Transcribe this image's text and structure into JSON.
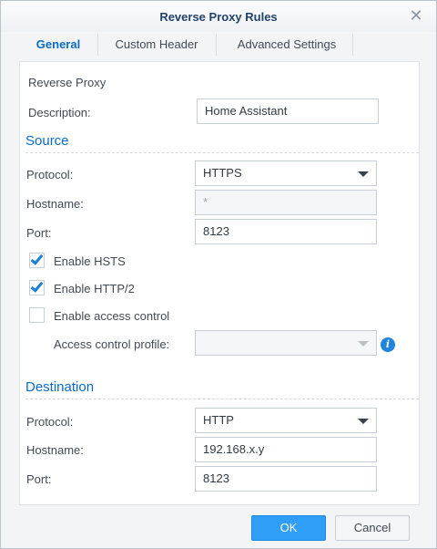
{
  "dialog": {
    "title": "Reverse Proxy Rules",
    "close_icon": "close-icon"
  },
  "tabs": [
    {
      "label": "General",
      "active": true
    },
    {
      "label": "Custom Header",
      "active": false
    },
    {
      "label": "Advanced Settings",
      "active": false
    }
  ],
  "general": {
    "group_label": "Reverse Proxy",
    "description_label": "Description:",
    "description_value": "Home Assistant"
  },
  "source": {
    "heading": "Source",
    "protocol_label": "Protocol:",
    "protocol_value": "HTTPS",
    "hostname_label": "Hostname:",
    "hostname_value": "*",
    "port_label": "Port:",
    "port_value": "8123",
    "hsts_label": "Enable HSTS",
    "hsts_checked": true,
    "http2_label": "Enable HTTP/2",
    "http2_checked": true,
    "access_control_label": "Enable access control",
    "access_control_checked": false,
    "access_profile_label": "Access control profile:",
    "access_profile_value": "",
    "info_icon": "info-icon"
  },
  "destination": {
    "heading": "Destination",
    "protocol_label": "Protocol:",
    "protocol_value": "HTTP",
    "hostname_label": "Hostname:",
    "hostname_value": "192.168.x.y",
    "port_label": "Port:",
    "port_value": "8123"
  },
  "footer": {
    "ok_label": "OK",
    "cancel_label": "Cancel"
  },
  "colors": {
    "accent": "#0a6bc4",
    "primary_button": "#2f9ef6",
    "checkbox_tick": "#1a7fd7"
  }
}
